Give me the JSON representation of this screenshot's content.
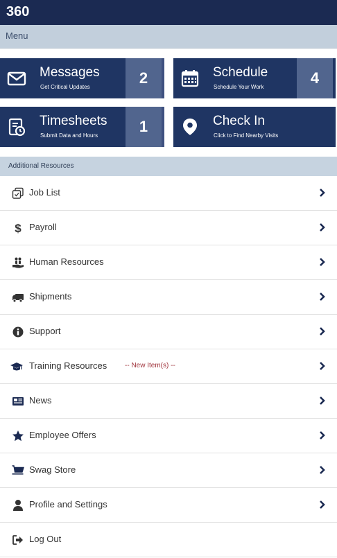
{
  "app": {
    "title": "360"
  },
  "menu": {
    "label": "Menu"
  },
  "tiles": [
    {
      "title": "Messages",
      "subtitle": "Get Critical Updates",
      "count": "2",
      "icon": "envelope-icon"
    },
    {
      "title": "Schedule",
      "subtitle": "Schedule Your Work",
      "count": "4",
      "icon": "calendar-icon"
    },
    {
      "title": "Timesheets",
      "subtitle": "Submit Data and Hours",
      "count": "1",
      "icon": "timesheet-icon"
    },
    {
      "title": "Check In",
      "subtitle": "Click to Find Nearby Visits",
      "icon": "map-pin-icon"
    }
  ],
  "resources": {
    "header": "Additional Resources",
    "items": [
      {
        "label": "Job List",
        "icon": "job-list-icon"
      },
      {
        "label": "Payroll",
        "icon": "dollar-icon"
      },
      {
        "label": "Human Resources",
        "icon": "hand-people-icon"
      },
      {
        "label": "Shipments",
        "icon": "truck-icon"
      },
      {
        "label": "Support",
        "icon": "info-icon"
      },
      {
        "label": "Training Resources",
        "icon": "graduation-cap-icon",
        "note": "-- New Item(s) --"
      },
      {
        "label": "News",
        "icon": "newspaper-icon"
      },
      {
        "label": "Employee Offers",
        "icon": "star-icon"
      },
      {
        "label": "Swag Store",
        "icon": "cart-icon"
      },
      {
        "label": "Profile and Settings",
        "icon": "user-icon"
      },
      {
        "label": "Log Out",
        "icon": "sign-out-icon"
      }
    ]
  },
  "colors": {
    "navy": "#1b2a52",
    "tile": "#1f3563",
    "badge": "#51658e",
    "menu_bg": "#c2cfdc",
    "note": "#a0343c"
  }
}
